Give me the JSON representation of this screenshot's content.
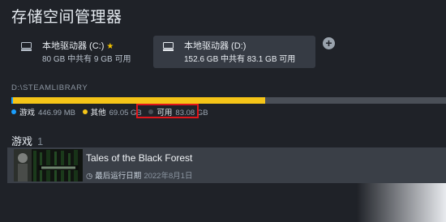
{
  "page": {
    "title": "存储空间管理器"
  },
  "drives": [
    {
      "name": "本地驱动器 (C:)",
      "default": true,
      "usage": "80 GB 中共有 9 GB 可用",
      "selected": false
    },
    {
      "name": "本地驱动器 (D:)",
      "default": false,
      "usage": "152.6 GB 中共有 83.1 GB 可用",
      "selected": true
    }
  ],
  "add_drive_glyph": "+",
  "library": {
    "path": "D:\\STEAMLIBRARY",
    "usage_fraction": {
      "games": 0.0029,
      "other": 0.582,
      "free": 0.415
    },
    "legend": [
      {
        "label": "游戏",
        "value": "446.99 MB",
        "color": "#1a9fff"
      },
      {
        "label": "其他",
        "value": "69.05 GB",
        "color": "#f5c518"
      },
      {
        "label": "可用",
        "value": "83.08 GB",
        "color": "#4a4f57"
      }
    ]
  },
  "games_section": {
    "label": "游戏",
    "count": "1"
  },
  "games": [
    {
      "title": "Tales of the Black Forest",
      "last_played_label": "最后运行日期",
      "last_played": "2022年8月1日"
    }
  ],
  "colors": {
    "accent_blue": "#1a9fff",
    "accent_yellow": "#f5c518",
    "highlight": "#e0161c"
  }
}
